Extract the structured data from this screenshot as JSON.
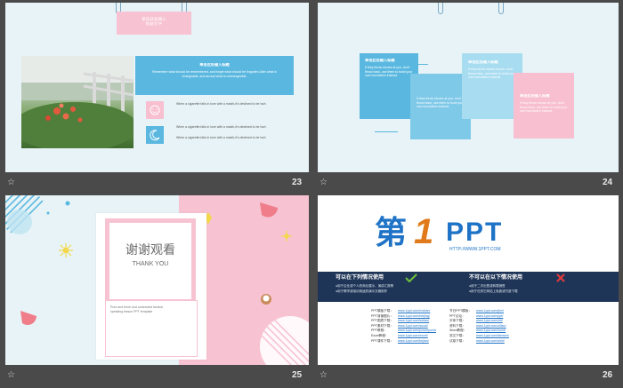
{
  "slides": [
    {
      "number": "23",
      "banner_title": "单击此处输入",
      "banner_sub": "标题文字",
      "panel_title": "单击此处输入标题",
      "panel_text": "Remember what should be remembered, and forget what should be forgotten.Alter what is changeable, and accept what is unchangeable.",
      "item1_text": "When a cigarette falls in love with a match,it's destined to be hurt.",
      "item2_text": "When a cigarette falls in love with a match,it's destined to be hurt.",
      "item3_text": "When a cigarette falls in love with a match,it's destined to be hurt."
    },
    {
      "number": "24",
      "box1_title": "单击此处输入标题",
      "box1_text": "If they throw stones at you, don't throw back, use them to build your own foundation instead.",
      "box2_text": "If they throw stones at you, don't throw back, use them to build your own foundation instead.",
      "box3_title": "单击此处输入标题",
      "box3_text": "If they throw stones at you, don't throw back, use them to build your own foundation instead.",
      "box4_title": "单击此处输入标题",
      "box4_text": "If they throw stones at you, don't throw back, use them to build your own foundation instead."
    },
    {
      "number": "25",
      "title_cn": "谢谢观看",
      "title_en": "THANK YOU",
      "desc": "Pure and fresh and contracted fashion speaking lesson PPT template"
    },
    {
      "number": "26",
      "logo_char": "第",
      "logo_one": "1",
      "logo_ppt": "PPT",
      "logo_url": "HTTP://WWW.1PPT.COM",
      "allowed_title": "可以在下列情况使用",
      "allowed_items": [
        "●用于企业或个人的商业展示、演讲汇报等",
        "●用于教学或培训用途的演示文稿制作"
      ],
      "forbidden_title": "不可以在以下情况使用",
      "forbidden_items": [
        "●用于二次出售或转载销售",
        "●用于在其它网站上免费或付费下载"
      ],
      "links_left": [
        {
          "label": "PPT模板下载：",
          "url": "www.1ppt.com/moban/"
        },
        {
          "label": "PPT背景图片：",
          "url": "www.1ppt.com/beijing/"
        },
        {
          "label": "PPT图表下载：",
          "url": "www.1ppt.com/tubiao/"
        },
        {
          "label": "PPT素材下载：",
          "url": "www.1ppt.com/sucai/"
        },
        {
          "label": "PPT教程：",
          "url": "www.1ppt.com/powerpoint/"
        },
        {
          "label": "Excel教程：",
          "url": "www.1ppt.com/excel/"
        },
        {
          "label": "PPT课件下载：",
          "url": "www.1ppt.com/kejian/"
        }
      ],
      "links_right": [
        {
          "label": "节日PPT模板：",
          "url": "www.1ppt.com/jieri/"
        },
        {
          "label": "PPT论坛：",
          "url": "www.1ppt.com/ppt/"
        },
        {
          "label": "字体下载：",
          "url": "www.1ppt.com/ziti/"
        },
        {
          "label": "资料下载：",
          "url": "www.1ppt.com/ziliao/"
        },
        {
          "label": "Word教程：",
          "url": "www.1ppt.com/word/"
        },
        {
          "label": "范文下载：",
          "url": "www.1ppt.com/fanwen/"
        },
        {
          "label": "试卷下载：",
          "url": "www.1ppt.com/shiti/"
        }
      ]
    }
  ],
  "star_glyph": "☆",
  "icons": {
    "smile": "smile-icon",
    "moon": "moon-icon",
    "check": "check-icon",
    "cross": "cross-icon"
  },
  "colors": {
    "blue": "#5ab8e0",
    "pink": "#f7bfcf",
    "navy": "#1f3557",
    "bg": "#e8f3f6"
  }
}
